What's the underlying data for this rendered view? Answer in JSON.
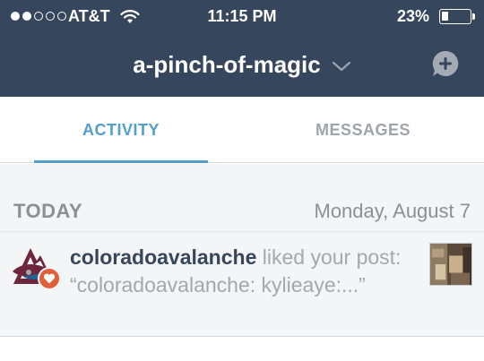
{
  "status_bar": {
    "carrier": "AT&T",
    "time": "11:15 PM",
    "battery_percent": "23%",
    "battery_level": 0.23,
    "signal_bars_filled": 2,
    "signal_bars_total": 5
  },
  "header": {
    "blog_name": "a-pinch-of-magic",
    "accent_color": "#36465d"
  },
  "tabs": [
    {
      "label": "ACTIVITY",
      "active": true
    },
    {
      "label": "MESSAGES",
      "active": false
    }
  ],
  "activity": {
    "section_label": "TODAY",
    "section_date": "Monday, August 7",
    "items": [
      {
        "username": "coloradoavalanche",
        "action_text": " liked your post: “coloradoavalanche: kylieaye:...”",
        "badge_icon": "heart-icon",
        "badge_color": "#e25f3a"
      }
    ]
  },
  "colors": {
    "link_blue": "#529ecc",
    "muted_gray": "#9ea4aa"
  }
}
